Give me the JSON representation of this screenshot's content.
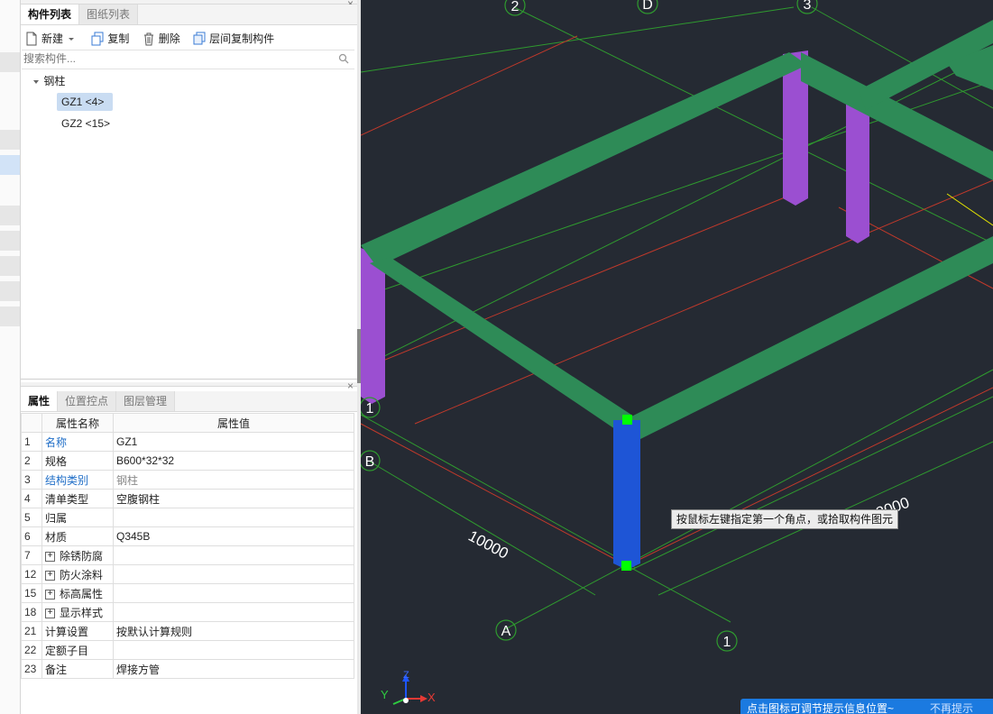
{
  "component_panel": {
    "tabs": [
      "构件列表",
      "图纸列表"
    ],
    "toolbar": {
      "new_label": "新建",
      "copy_label": "复制",
      "delete_label": "删除",
      "floor_copy_label": "层间复制构件"
    },
    "search": {
      "placeholder": "搜索构件..."
    },
    "tree": {
      "group_label": "钢柱",
      "items": [
        {
          "label": "GZ1 <4>",
          "selected": true
        },
        {
          "label": "GZ2 <15>",
          "selected": false
        }
      ]
    }
  },
  "property_panel": {
    "tabs": [
      "属性",
      "位置控点",
      "图层管理"
    ],
    "headers": {
      "name": "属性名称",
      "value": "属性值"
    },
    "rows": [
      {
        "num": "1",
        "name": "名称",
        "value": "GZ1",
        "name_color": "blue",
        "value_gray": false,
        "expandable": false
      },
      {
        "num": "2",
        "name": "规格",
        "value": "B600*32*32",
        "name_color": "normal",
        "value_gray": false,
        "expandable": false
      },
      {
        "num": "3",
        "name": "结构类别",
        "value": "钢柱",
        "name_color": "blue",
        "value_gray": true,
        "expandable": false
      },
      {
        "num": "4",
        "name": "清单类型",
        "value": "空腹钢柱",
        "name_color": "normal",
        "value_gray": false,
        "expandable": false
      },
      {
        "num": "5",
        "name": "归属",
        "value": "",
        "name_color": "normal",
        "value_gray": false,
        "expandable": false
      },
      {
        "num": "6",
        "name": "材质",
        "value": "Q345B",
        "name_color": "normal",
        "value_gray": false,
        "expandable": false
      },
      {
        "num": "7",
        "name": "除锈防腐",
        "value": "",
        "name_color": "normal",
        "value_gray": false,
        "expandable": true
      },
      {
        "num": "12",
        "name": "防火涂料",
        "value": "",
        "name_color": "normal",
        "value_gray": false,
        "expandable": true
      },
      {
        "num": "15",
        "name": "标高属性",
        "value": "",
        "name_color": "normal",
        "value_gray": false,
        "expandable": true
      },
      {
        "num": "18",
        "name": "显示样式",
        "value": "",
        "name_color": "normal",
        "value_gray": false,
        "expandable": true
      },
      {
        "num": "21",
        "name": "计算设置",
        "value": "按默认计算规则",
        "name_color": "normal",
        "value_gray": false,
        "expandable": false
      },
      {
        "num": "22",
        "name": "定额子目",
        "value": "",
        "name_color": "normal",
        "value_gray": false,
        "expandable": false
      },
      {
        "num": "23",
        "name": "备注",
        "value": "焊接方管",
        "name_color": "normal",
        "value_gray": false,
        "expandable": false
      }
    ]
  },
  "viewport": {
    "axis_labels": {
      "a": "A",
      "b": "B",
      "d": "D",
      "n1_bottom": "1",
      "n1_left": "1",
      "n2": "2",
      "n3": "3"
    },
    "dimensions": {
      "width": "10000",
      "length": "18000"
    },
    "tooltip": "按鼠标左键指定第一个角点，或拾取构件图元",
    "banner": {
      "message": "点击图标可调节提示信息位置~",
      "dismiss": "不再提示"
    },
    "axis_indicator": {
      "x": "X",
      "y": "Y",
      "z": "Z"
    },
    "colors": {
      "background": "#252a33",
      "beam": "#2e8b57",
      "column": "#9b4fd1",
      "selected_column": "#1e55d6",
      "grip": "#00ff00"
    }
  }
}
